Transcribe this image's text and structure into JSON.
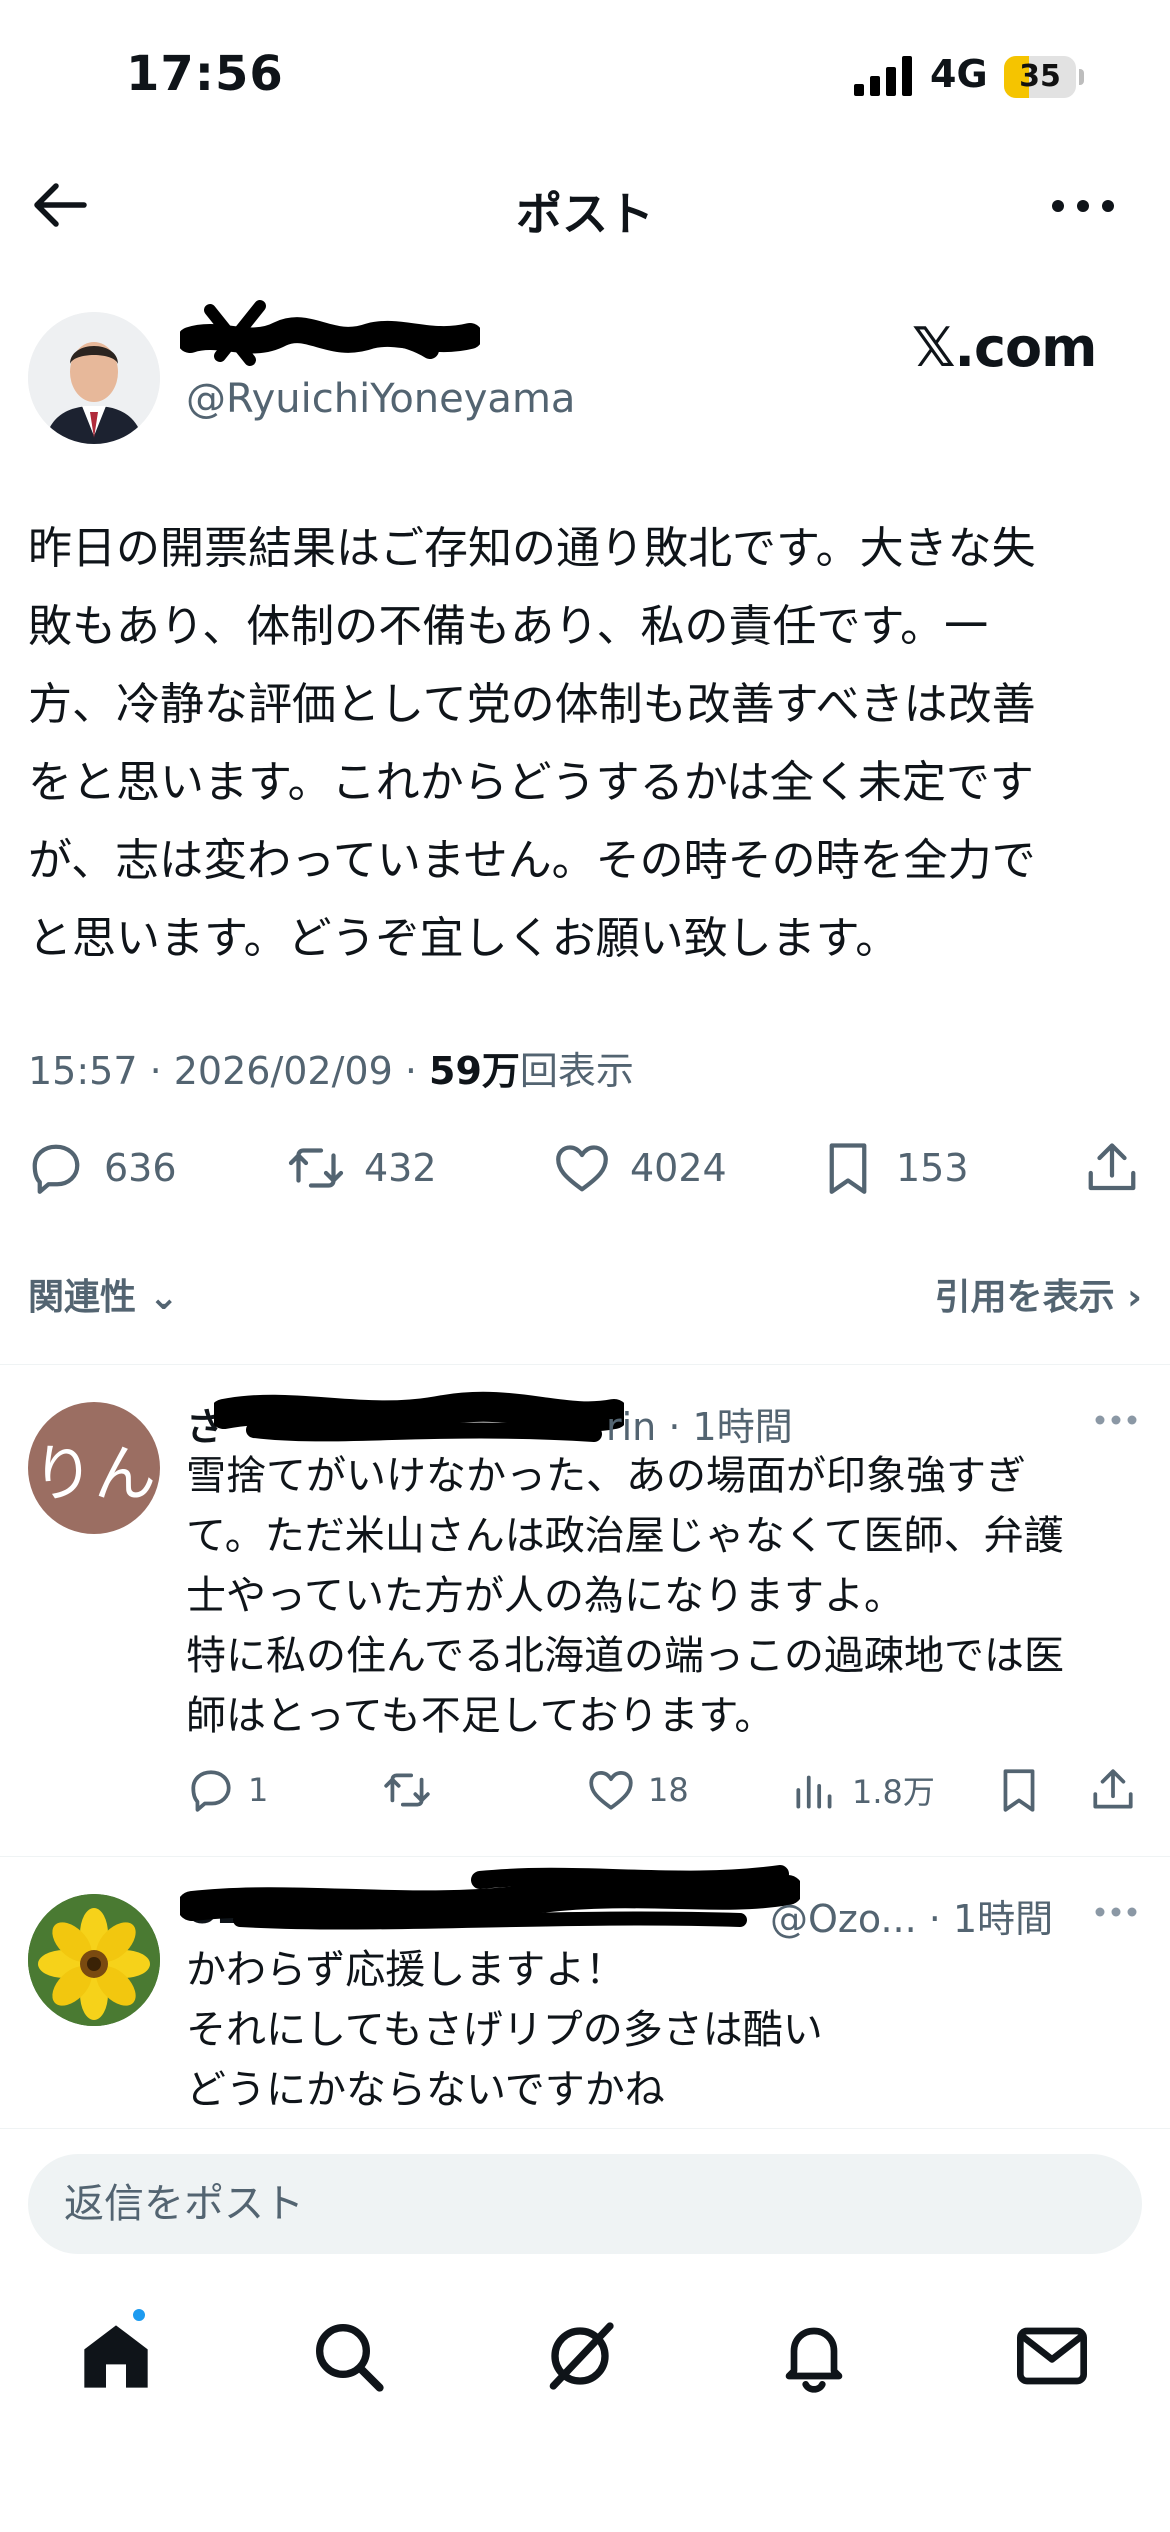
{
  "status_bar": {
    "time": "17:56",
    "network": "4G",
    "battery": "35",
    "battery_level": 0.35
  },
  "header": {
    "title": "ポスト"
  },
  "post": {
    "handle": "@RyuichiYoneyama",
    "embed_badge": "𝕏.com",
    "text": "昨日の開票結果はご存知の通り敗北です。大きな失\n敗もあり、体制の不備もあり、私の責任です。一\n方、冷静な評価として党の体制も改善すべきは改善\nをと思います。これからどうするかは全く未定です\nが、志は変わっていません。その時その時を全力で\nと思います。どうぞ宜しくお願い致します。",
    "time": "15:57 · 2026/02/09 · ",
    "views_count": "59万",
    "views_label": "回表示",
    "stats": {
      "replies": "636",
      "reposts": "432",
      "likes": "4024",
      "bookmarks": "153"
    },
    "sort_label": "関連性",
    "quotes_label": "引用を表示"
  },
  "replies": [
    {
      "name": "さ",
      "handle_tail": "rin",
      "time": "· 1時間",
      "avatar_text": "りん",
      "text": "雪捨てがいけなかった、あの場面が印象強すぎ\nて。ただ米山さんは政治屋じゃなくて医師、弁護\n士やっていた方が人の為になりますよ。\n特に私の住んでる北海道の端っこの過疎地では医\n師はとっても不足しております。",
      "stats": {
        "replies": "1",
        "likes": "18",
        "views": "1.8万"
      }
    },
    {
      "name": "OZO",
      "handle": "@Ozo...",
      "time": "· 1時間",
      "text": "かわらず応援しますよ！\nそれにしてもさげリプの多さは酷い\nどうにかならないですかね"
    }
  ],
  "composer": {
    "placeholder": "返信をポスト"
  },
  "tabbar": {
    "items": [
      "home-icon",
      "search-icon",
      "grok-icon",
      "notifications-icon",
      "messages-icon"
    ]
  }
}
